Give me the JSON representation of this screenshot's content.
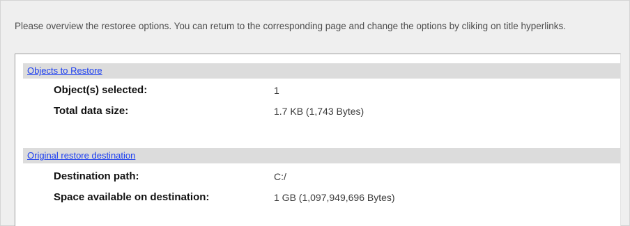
{
  "intro_text": "Please overview the restoree options. You can retum to the corresponding page and change the options by cliking on title hyperlinks.",
  "sections": [
    {
      "title": "Objects to Restore",
      "rows": [
        {
          "label": "Object(s) selected:",
          "value": "1"
        },
        {
          "label": "Total data size:",
          "value": "1.7 KB (1,743 Bytes)"
        }
      ]
    },
    {
      "title": "Original restore destination",
      "rows": [
        {
          "label": "Destination path:",
          "value": "C:/"
        },
        {
          "label": "Space available on destination:",
          "value": "1 GB (1,097,949,696 Bytes)"
        }
      ]
    }
  ],
  "colors": {
    "link": "#1a3df0",
    "header_band": "#dcdcdc",
    "background": "#efefef",
    "panel": "#ffffff"
  }
}
